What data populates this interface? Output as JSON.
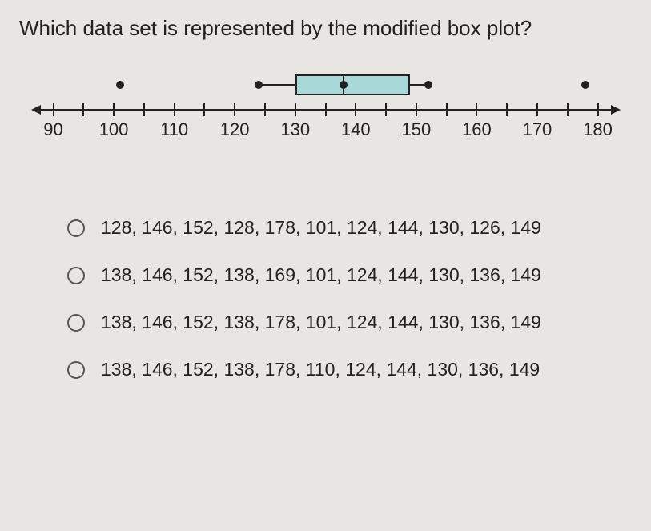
{
  "question": "Which data set is represented by the modified box plot?",
  "chart_data": {
    "type": "boxplot",
    "axis_min": 90,
    "axis_max": 180,
    "tick_interval": 5,
    "label_interval": 10,
    "outliers": [
      101,
      178
    ],
    "whisker_low": 124,
    "q1": 130,
    "median": 138,
    "q3": 149,
    "whisker_high": 152,
    "box_color": "#a8d8d8"
  },
  "options": [
    {
      "text": "128, 146, 152, 128, 178, 101, 124, 144, 130, 126, 149"
    },
    {
      "text": "138, 146, 152, 138, 169, 101, 124, 144, 130, 136, 149"
    },
    {
      "text": "138, 146, 152, 138, 178, 101, 124, 144, 130, 136, 149"
    },
    {
      "text": "138, 146, 152, 138, 178, 110, 124, 144, 130, 136, 149"
    }
  ]
}
